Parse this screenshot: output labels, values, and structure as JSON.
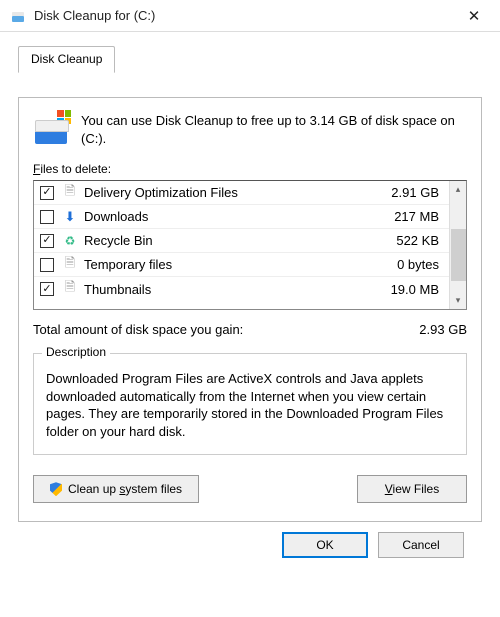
{
  "window": {
    "title": "Disk Cleanup for  (C:)"
  },
  "tab": {
    "label": "Disk Cleanup"
  },
  "intro": "You can use Disk Cleanup to free up to 3.14 GB of disk space on  (C:).",
  "files_label_pre": "F",
  "files_label_post": "iles to delete:",
  "items": [
    {
      "checked": true,
      "icon": "page",
      "label": "Delivery Optimization Files",
      "size": "2.91 GB"
    },
    {
      "checked": false,
      "icon": "download",
      "label": "Downloads",
      "size": "217 MB"
    },
    {
      "checked": true,
      "icon": "recycle",
      "label": "Recycle Bin",
      "size": "522 KB"
    },
    {
      "checked": false,
      "icon": "page",
      "label": "Temporary files",
      "size": "0 bytes"
    },
    {
      "checked": true,
      "icon": "page",
      "label": "Thumbnails",
      "size": "19.0 MB"
    }
  ],
  "total": {
    "label": "Total amount of disk space you gain:",
    "value": "2.93 GB"
  },
  "description": {
    "heading": "Description",
    "text": "Downloaded Program Files are ActiveX controls and Java applets downloaded automatically from the Internet when you view certain pages. They are temporarily stored in the Downloaded Program Files folder on your hard disk."
  },
  "buttons": {
    "cleanup_pre": "Clean up ",
    "cleanup_ul": "s",
    "cleanup_post": "ystem files",
    "view_ul": "V",
    "view_post": "iew Files",
    "ok": "OK",
    "cancel": "Cancel"
  }
}
